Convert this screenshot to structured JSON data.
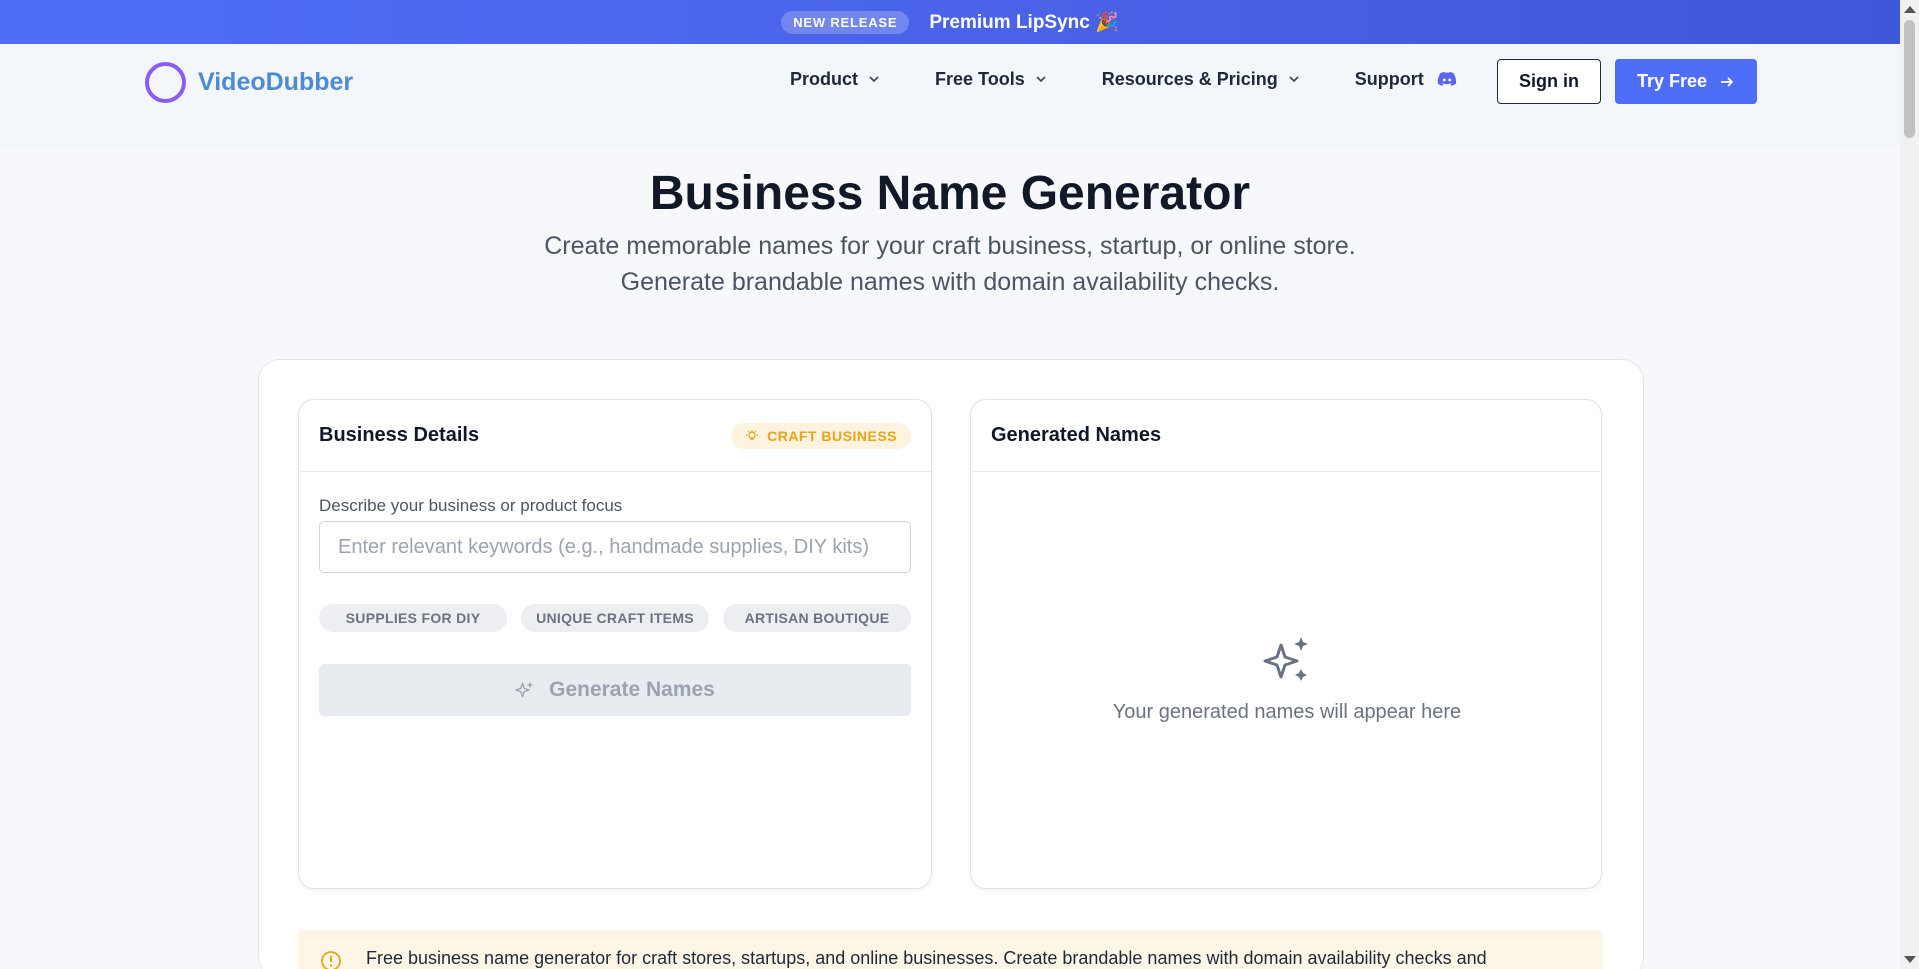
{
  "announcement": {
    "badge": "NEW RELEASE",
    "message": "Premium LipSync 🎉"
  },
  "nav": {
    "brand": "VideoDubber",
    "items": [
      {
        "label": "Product"
      },
      {
        "label": "Free Tools"
      },
      {
        "label": "Resources & Pricing"
      }
    ],
    "support": "Support",
    "sign_in": "Sign in",
    "try_free": "Try Free"
  },
  "hero": {
    "title": "Business Name Generator",
    "subtitle": "Create memorable names for your craft business, startup, or online store. Generate brandable names with domain availability checks."
  },
  "details_panel": {
    "title": "Business Details",
    "badge": "CRAFT BUSINESS",
    "field_label": "Describe your business or product focus",
    "input_value": "",
    "input_placeholder": "Enter relevant keywords (e.g., handmade supplies, DIY kits)",
    "chips": [
      "SUPPLIES FOR DIY",
      "UNIQUE CRAFT ITEMS",
      "ARTISAN BOUTIQUE"
    ],
    "generate_label": "Generate Names"
  },
  "results_panel": {
    "title": "Generated Names",
    "empty_text": "Your generated names will appear here"
  },
  "info": {
    "text": "Free business name generator for craft stores, startups, and online businesses. Create brandable names with domain availability checks and"
  },
  "colors": {
    "accent": "#4f6ef7",
    "logo_ring": "#8b5cf6",
    "badge_amber": "#e8a317"
  },
  "icons": [
    "chevron-down-icon",
    "discord-icon",
    "arrow-right-icon",
    "lightbulb-icon",
    "sparkles-icon",
    "info-icon"
  ]
}
